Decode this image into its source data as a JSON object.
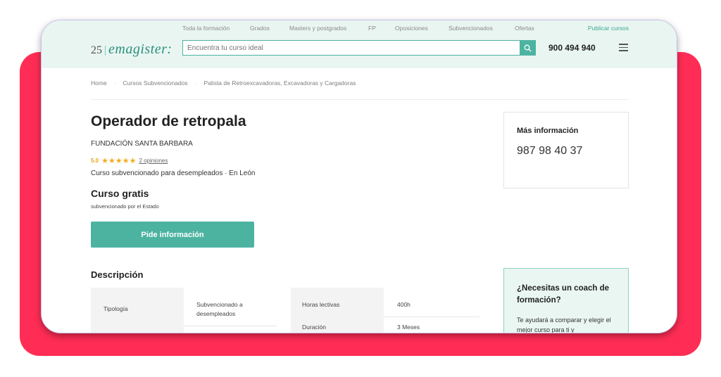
{
  "header": {
    "nav": [
      "Toda la formación",
      "Grados",
      "Masters y postgrados",
      "FP",
      "Oposiciones",
      "Subvencionados",
      "Ofertas"
    ],
    "publish_label": "Publicar cursos",
    "logo_number": "25",
    "logo_text": "emagister:",
    "search_placeholder": "Encuentra tu curso ideal",
    "phone": "900 494 940"
  },
  "breadcrumb": [
    "Home",
    "Cursos Subvencionados",
    "Palista de Retroexcavadoras, Excavadoras y Cargadoras"
  ],
  "course": {
    "title": "Operador de retropala",
    "center": "FUNDACIÓN SANTA BARBARA",
    "rating": "5.0",
    "stars": "★★★★★",
    "opinions": "2 opiniones",
    "description_line": "Curso subvencionado para desempleados · En León",
    "price": "Curso gratis",
    "price_sub": "subvencionado por el Estado",
    "cta": "Pide información"
  },
  "description": {
    "heading": "Descripción",
    "rows": [
      {
        "label": "Tipología",
        "value": "Subvencionado a desempleados"
      },
      {
        "label": "Horas lectivas",
        "value": "400h"
      },
      {
        "label": "Duración",
        "value": "3 Meses"
      }
    ]
  },
  "sidebar": {
    "info_title": "Más información",
    "info_phone": "987 98 40 37",
    "coach_title": "¿Necesitas un coach de formación?",
    "coach_text": "Te ayudará a comparar y elegir el mejor curso para ti y"
  },
  "colors": {
    "accent": "#4db3a1",
    "background_card": "#ff2d55",
    "header_bg": "#e9f5f1",
    "star": "#f0ad1f"
  }
}
